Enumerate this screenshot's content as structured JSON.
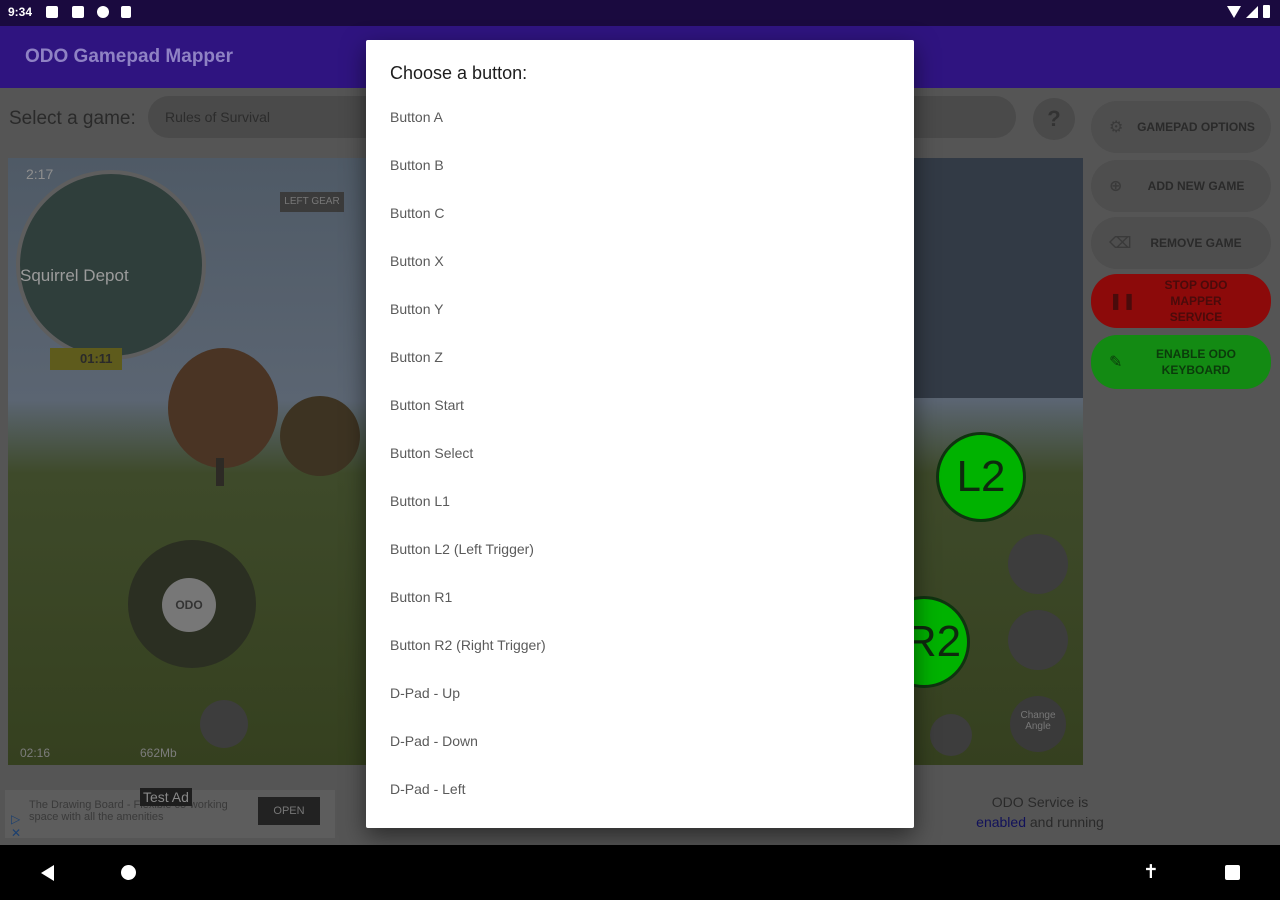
{
  "status_bar": {
    "time": "9:34",
    "left_icons": [
      "gamepad-icon",
      "photo-icon",
      "vpn-icon",
      "sd-card-icon"
    ],
    "right_icons": [
      "wifi-icon",
      "signal-icon",
      "battery-icon"
    ]
  },
  "app_bar": {
    "title": "ODO Gamepad Mapper"
  },
  "main": {
    "select_label": "Select a game:",
    "select_value": "Rules of Survival",
    "help_label": "?"
  },
  "game_preview": {
    "hud_time": "2:17",
    "minimap_label": "Squirrel Depot",
    "timer": "01:11",
    "left_gear_tag": "LEFT GEAR",
    "bottom_hud_time": "02:16",
    "bottom_hud_speed": "662Mb",
    "l2_label": "L2",
    "r2_label": "R2",
    "change_angle": "Change Angle"
  },
  "side_buttons": [
    {
      "label": "GAMEPAD OPTIONS",
      "icon": "wrench-icon"
    },
    {
      "label": "ADD NEW GAME",
      "icon": "add-circle-icon"
    },
    {
      "label": "REMOVE GAME",
      "icon": "trash-icon"
    },
    {
      "label": "STOP ODO MAPPER SERVICE",
      "icon": "pause-icon"
    },
    {
      "label": "ENABLE ODO KEYBOARD",
      "icon": "pencil-icon"
    }
  ],
  "ad_bar": {
    "test_ad_label": "Test Ad",
    "ad_text": "The Drawing Board - Flexible co-working space with all the amenities",
    "ad_button": "OPEN",
    "service_line1": "ODO Service is",
    "service_enabled": "enabled",
    "service_rest": " and running"
  },
  "dialog": {
    "title": "Choose a button:",
    "options": [
      "Button A",
      "Button B",
      "Button C",
      "Button X",
      "Button Y",
      "Button Z",
      "Button Start",
      "Button Select",
      "Button L1",
      "Button L2 (Left Trigger)",
      "Button R1",
      "Button R2 (Right Trigger)",
      "D-Pad - Up",
      "D-Pad - Down",
      "D-Pad - Left"
    ]
  },
  "nav_bar": {
    "icons": [
      "back-icon",
      "home-icon",
      "accessibility-icon",
      "recents-icon"
    ]
  },
  "colors": {
    "app_bar": "#2f1480",
    "status_bar": "#1a0a3f",
    "stop_button": "#d11a1a",
    "enable_button": "#22d322",
    "gamepad_green": "#00cc00"
  }
}
